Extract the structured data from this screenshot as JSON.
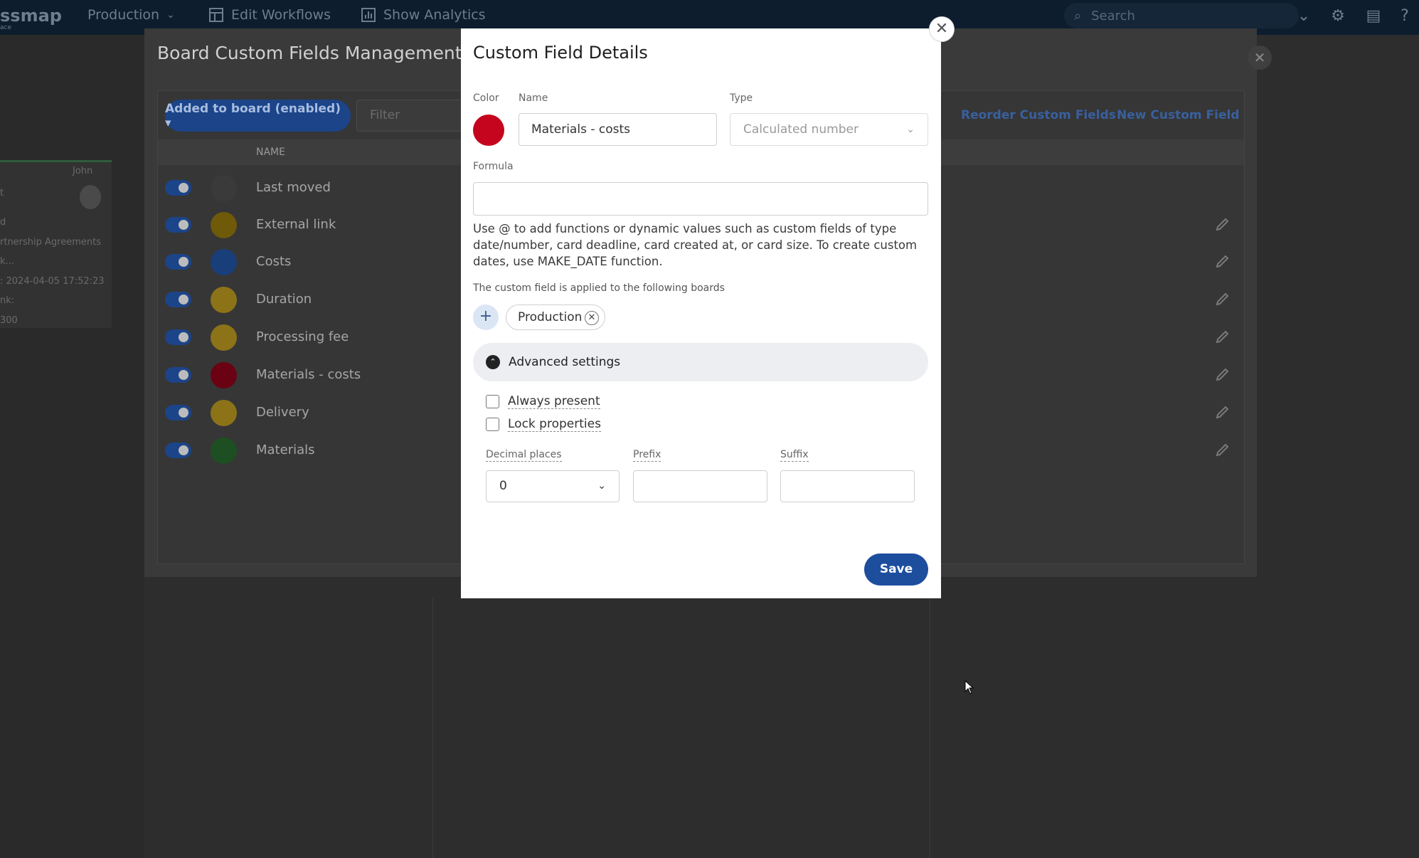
{
  "topbar": {
    "logo": "ssmap",
    "logo_sub": "ace",
    "board_switch": "Production",
    "edit_workflows": "Edit Workflows",
    "show_analytics": "Show Analytics",
    "search_placeholder": "Search"
  },
  "card": {
    "user": "John",
    "line1": "t",
    "line2": "d",
    "line3": "rtnership Agreements",
    "line4": "k...",
    "line5": ": 2024-04-05 17:52:23",
    "line6": "nk:",
    "line7": "300"
  },
  "management": {
    "title": "Board Custom Fields Management",
    "added_button": "Added to board (enabled) ▾",
    "filter_placeholder": "Filter",
    "reorder_link": "Reorder Custom Fields",
    "new_link": "New Custom Field",
    "column_name": "NAME",
    "fields": [
      {
        "name": "Last moved",
        "color": "#3a3a3a"
      },
      {
        "name": "External link",
        "color": "#6e5a08"
      },
      {
        "name": "Costs",
        "color": "#193f7b"
      },
      {
        "name": "Duration",
        "color": "#8c7318"
      },
      {
        "name": "Processing fee",
        "color": "#8c7318"
      },
      {
        "name": "Materials - costs",
        "color": "#6a0213"
      },
      {
        "name": "Delivery",
        "color": "#8c7318"
      },
      {
        "name": "Materials",
        "color": "#1d4f22"
      }
    ]
  },
  "modal": {
    "title": "Custom Field Details",
    "color_label": "Color",
    "color_value": "#c5041d",
    "name_label": "Name",
    "name_value": "Materials - costs",
    "type_label": "Type",
    "type_value": "Calculated number",
    "formula_label": "Formula",
    "formula_value": "",
    "help_text": "Use @ to add functions or dynamic values such as custom fields of type date/number, card deadline, card created at, or card size. To create custom dates, use MAKE_DATE function.",
    "applied_label": "The custom field is applied to the following boards",
    "board_chip": "Production",
    "advanced_label": "Advanced settings",
    "always_present": "Always present",
    "lock_properties": "Lock properties",
    "decimal_label": "Decimal places",
    "decimal_value": "0",
    "prefix_label": "Prefix",
    "suffix_label": "Suffix",
    "save_label": "Save"
  }
}
